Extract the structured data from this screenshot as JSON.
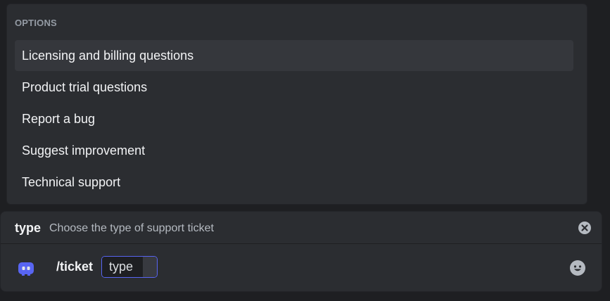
{
  "options": {
    "header": "OPTIONS",
    "items": [
      {
        "label": "Licensing and billing questions"
      },
      {
        "label": "Product trial questions"
      },
      {
        "label": "Report a bug"
      },
      {
        "label": "Suggest improvement"
      },
      {
        "label": "Technical support"
      }
    ]
  },
  "composer": {
    "param_name": "type",
    "param_description": "Choose the type of support ticket",
    "command": "/ticket",
    "option_label": "type",
    "icons": {
      "close": "close-circle-icon",
      "bot": "bot-avatar-icon",
      "emoji": "emoji-smile-icon"
    }
  },
  "colors": {
    "background": "#1e1f22",
    "panel": "#2b2d31",
    "selected": "#35373c",
    "accent": "#5865f2",
    "text": "#f2f3f5",
    "muted": "#949ba4"
  }
}
